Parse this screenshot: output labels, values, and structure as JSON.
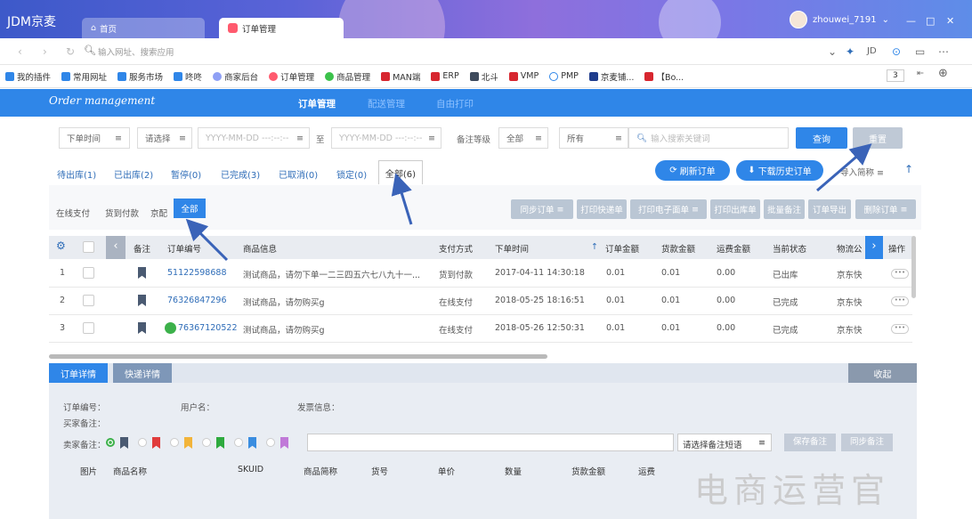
{
  "browser": {
    "brand": "JDM京麦",
    "tabs": [
      {
        "label": "首页"
      },
      {
        "label": "订单管理"
      }
    ],
    "user": "zhouwei_7191",
    "address_placeholder": "输入网址、搜索应用",
    "right_tools": [
      "JD"
    ],
    "bookmarks": [
      "我的插件",
      "常用网址",
      "服务市场",
      "咚咚",
      "商家后台",
      "订单管理",
      "商品管理",
      "MAN端",
      "ERP",
      "北斗",
      "VMP",
      "PMP",
      "京麦铺...",
      "【Bo..."
    ],
    "bookmark_count": "3"
  },
  "app": {
    "logo": "Order management",
    "nav": [
      "订单管理",
      "配送管理",
      "自由打印"
    ]
  },
  "filter": {
    "time_label": "下单时间",
    "select_placeholder": "请选择",
    "date_from": "YYYY-MM-DD ---:--:--",
    "to": "至",
    "date_to": "YYYY-MM-DD ---:--:--",
    "remark_level_label": "备注等级",
    "remark_level_value": "全部",
    "all_label": "所有",
    "search_placeholder": "输入搜索关键词",
    "query_btn": "查询",
    "reset_btn": "重置"
  },
  "status_tabs": [
    {
      "label": "待出库(1)"
    },
    {
      "label": "已出库(2)"
    },
    {
      "label": "暂停(0)"
    },
    {
      "label": "已完成(3)"
    },
    {
      "label": "已取消(0)"
    },
    {
      "label": "锁定(0)"
    }
  ],
  "status_active": "全部(6)",
  "actions": {
    "refresh": "刷新订单",
    "download": "下载历史订单",
    "export_label": "导入简称"
  },
  "pay_filter": [
    "在线支付",
    "货到付款",
    "京配"
  ],
  "pay_active": "全部",
  "ops": [
    "同步订单",
    "打印快递单",
    "打印电子面单",
    "打印出库单",
    "批量备注",
    "订单导出",
    "删除订单"
  ],
  "table": {
    "headers": [
      "备注",
      "订单编号",
      "商品信息",
      "支付方式",
      "下单时间",
      "订单金额",
      "货款金额",
      "运费金额",
      "当前状态",
      "物流公",
      "操作"
    ],
    "rows": [
      {
        "idx": "1",
        "order_id": "51122598688",
        "product": "测试商品，请勿下单一二三四五六七八九十一...",
        "pay": "货到付款",
        "time": "2017-04-11 14:30:18",
        "amount": "0.01",
        "goods": "0.01",
        "freight": "0.00",
        "status": "已出库",
        "logistics": "京东快"
      },
      {
        "idx": "2",
        "order_id": "76326847296",
        "product": "测试商品，请勿购买g",
        "pay": "在线支付",
        "time": "2018-05-25 18:16:51",
        "amount": "0.01",
        "goods": "0.01",
        "freight": "0.00",
        "status": "已完成",
        "logistics": "京东快"
      },
      {
        "idx": "3",
        "order_id": "76367120522",
        "product": "测试商品，请勿购买g",
        "pay": "在线支付",
        "time": "2018-05-26 12:50:31",
        "amount": "0.01",
        "goods": "0.01",
        "freight": "0.00",
        "status": "已完成",
        "logistics": "京东快"
      }
    ],
    "more": "•••"
  },
  "detail": {
    "tabs": [
      "订单详情",
      "快递详情"
    ],
    "collapse": "收起",
    "order_no_label": "订单编号：",
    "buyer_label": "用户名：",
    "invoice_label": "发票信息：",
    "buyer_remark_label": "买家备注：",
    "seller_remark_label": "卖家备注：",
    "remark_select": "请选择备注短语",
    "save_remark": "保存备注",
    "sync_remark": "同步备注",
    "item_headers": [
      "图片",
      "商品名称",
      "SKUID",
      "商品简称",
      "货号",
      "单价",
      "数量",
      "货款金额",
      "运费"
    ]
  },
  "watermark": "电商运营官",
  "colors": {
    "primary": "#2f86e8",
    "link": "#2f6db8",
    "arrow": "#3a63b8"
  }
}
